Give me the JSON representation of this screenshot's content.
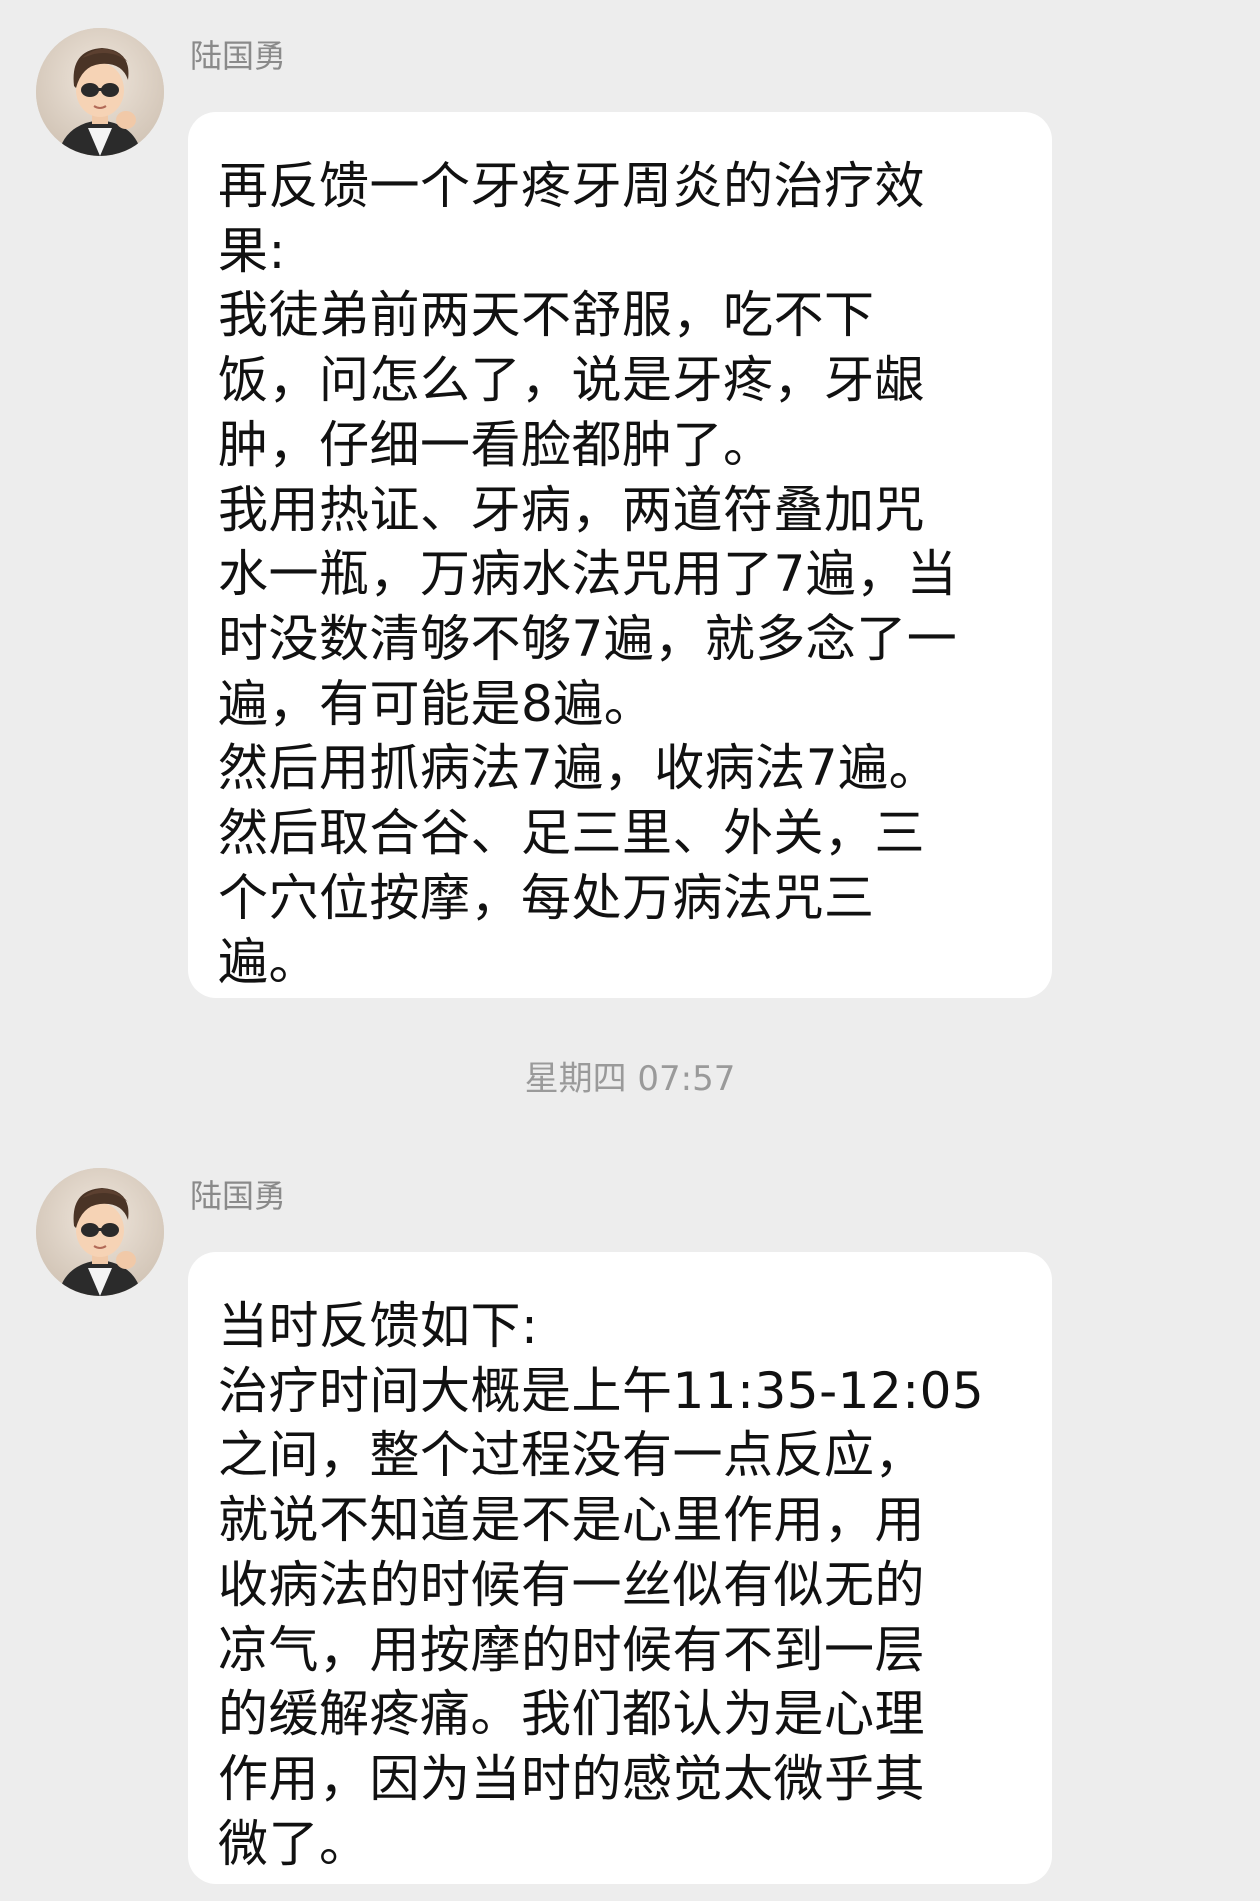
{
  "messages": [
    {
      "sender": "陆国勇",
      "lines": [
        "再反馈一个牙疼牙周炎的治疗效",
        "果:",
        "我徒弟前两天不舒服，吃不下",
        "饭，问怎么了，说是牙疼，牙龈",
        "肿，仔细一看脸都肿了。",
        "我用热证、牙病，两道符叠加咒",
        "水一瓶，万病水法咒用了7遍，当",
        "时没数清够不够7遍，就多念了一",
        "遍，有可能是8遍。",
        "然后用抓病法7遍，收病法7遍。",
        "然后取合谷、足三里、外关，三",
        "个穴位按摩，每处万病法咒三",
        "遍。"
      ]
    },
    {
      "sender": "陆国勇",
      "lines": [
        "当时反馈如下:",
        "治疗时间大概是上午11:35-12:05",
        "之间，整个过程没有一点反应，",
        "就说不知道是不是心里作用，用",
        "收病法的时候有一丝似有似无的",
        "凉气，用按摩的时候有不到一层",
        "的缓解疼痛。我们都认为是心理",
        "作用，因为当时的感觉太微乎其",
        "微了。"
      ]
    }
  ],
  "timestamp": "星期四 07:57",
  "colors": {
    "background": "#ededed",
    "bubble": "#ffffff",
    "text": "#111111",
    "sender": "#8a8a8a",
    "timestamp": "#9a9a9a"
  }
}
